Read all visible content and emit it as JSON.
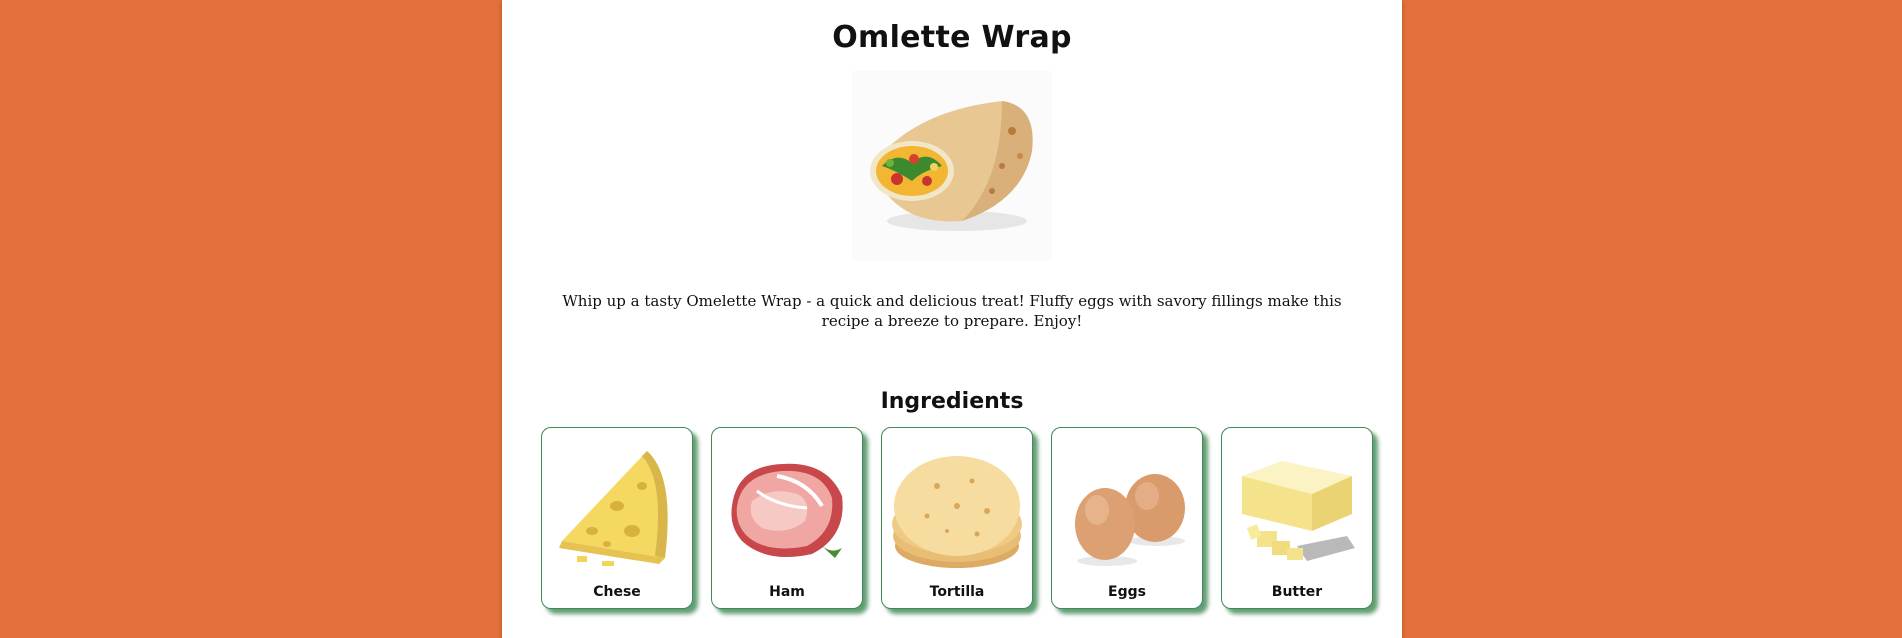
{
  "recipe": {
    "title": "Omlette Wrap",
    "image_icon": "omelette-wrap-image",
    "description": "Whip up a tasty Omelette Wrap - a quick and delicious treat! Fluffy eggs with savory fillings make this recipe a breeze to prepare. Enjoy!"
  },
  "ingredients": {
    "heading": "Ingredients",
    "items": [
      {
        "label": "Chese",
        "icon": "cheese-icon"
      },
      {
        "label": "Ham",
        "icon": "ham-icon"
      },
      {
        "label": "Tortilla",
        "icon": "tortilla-icon"
      },
      {
        "label": "Eggs",
        "icon": "eggs-icon"
      },
      {
        "label": "Butter",
        "icon": "butter-icon"
      }
    ]
  },
  "colors": {
    "background": "#e3703a",
    "card_border": "#3f8a57",
    "card_shadow": "#2e7d46"
  }
}
